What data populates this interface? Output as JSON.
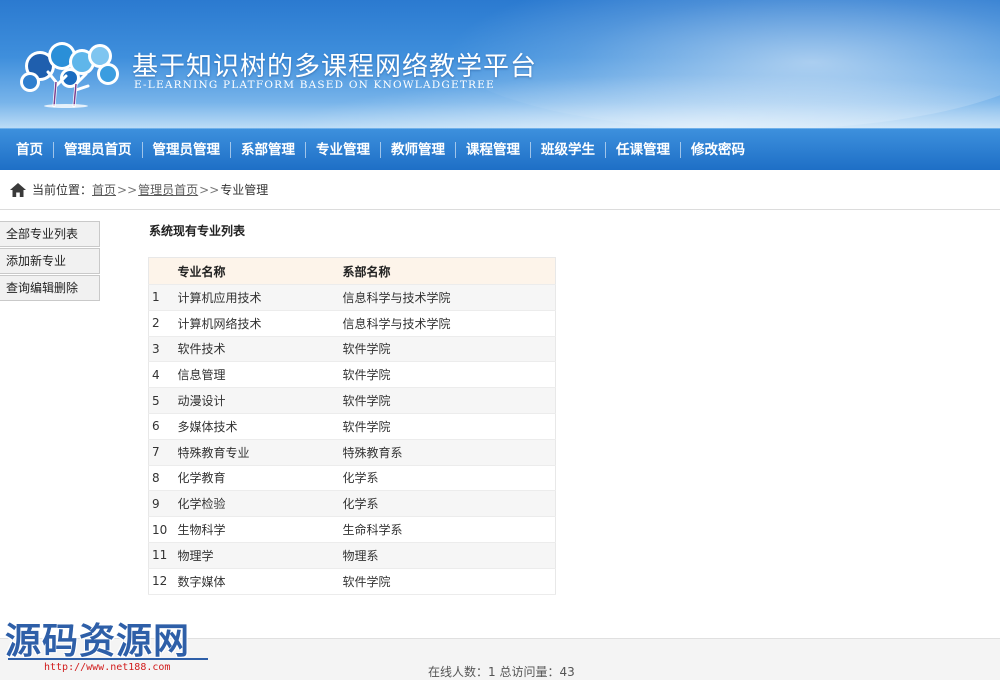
{
  "header": {
    "title": "基于知识树的多课程网络教学平台",
    "subtitle": "E-LEARNING PLATFORM BASED ON KNOWLADGETREE",
    "logo_icon": "tree-logo-icon"
  },
  "nav": {
    "items": [
      {
        "label": "首页"
      },
      {
        "label": "管理员首页"
      },
      {
        "label": "管理员管理"
      },
      {
        "label": "系部管理"
      },
      {
        "label": "专业管理"
      },
      {
        "label": "教师管理"
      },
      {
        "label": "课程管理"
      },
      {
        "label": "班级学生"
      },
      {
        "label": "任课管理"
      },
      {
        "label": "修改密码"
      }
    ]
  },
  "breadcrumb": {
    "prefix": "当前位置：",
    "links": [
      "首页",
      "管理员首页"
    ],
    "separator": ">>",
    "current": "专业管理"
  },
  "sidebar": {
    "items": [
      {
        "label": "全部专业列表"
      },
      {
        "label": "添加新专业"
      },
      {
        "label": "查询编辑删除"
      }
    ]
  },
  "main": {
    "title": "系统现有专业列表",
    "columns": [
      "专业名称",
      "系部名称"
    ],
    "rows": [
      {
        "num": "1",
        "name": "计算机应用技术",
        "dept": "信息科学与技术学院"
      },
      {
        "num": "2",
        "name": "计算机网络技术",
        "dept": "信息科学与技术学院"
      },
      {
        "num": "3",
        "name": "软件技术",
        "dept": "软件学院"
      },
      {
        "num": "4",
        "name": "信息管理",
        "dept": "软件学院"
      },
      {
        "num": "5",
        "name": "动漫设计",
        "dept": "软件学院"
      },
      {
        "num": "6",
        "name": "多媒体技术",
        "dept": "软件学院"
      },
      {
        "num": "7",
        "name": "特殊教育专业",
        "dept": "特殊教育系"
      },
      {
        "num": "8",
        "name": "化学教育",
        "dept": "化学系"
      },
      {
        "num": "9",
        "name": "化学检验",
        "dept": "化学系"
      },
      {
        "num": "10",
        "name": "生物科学",
        "dept": "生命科学系"
      },
      {
        "num": "11",
        "name": "物理学",
        "dept": "物理系"
      },
      {
        "num": "12",
        "name": "数字媒体",
        "dept": "软件学院"
      }
    ]
  },
  "footer": {
    "stats": "在线人数：1 总访问量：43"
  },
  "watermark": {
    "title": "源码资源网",
    "url": "http://www.net188.com"
  },
  "colors": {
    "nav_bg": "#2478cc",
    "header_bg": "#3f8fdc",
    "table_header_bg": "#fdf4ea"
  }
}
